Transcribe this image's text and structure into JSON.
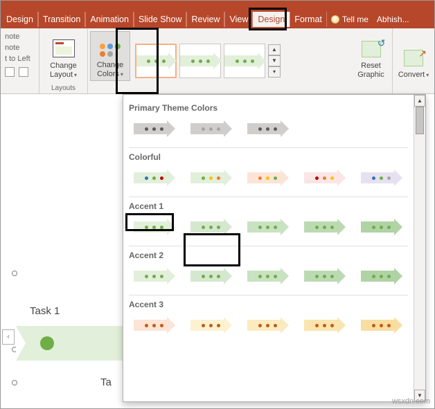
{
  "tabs": {
    "design": "Design",
    "transition": "Transition",
    "animation": "Animation",
    "slideshow": "Slide Show",
    "review": "Review",
    "view": "View",
    "design_tools": "Design",
    "format": "Format",
    "tellme": "Tell me",
    "account": "Abhish..."
  },
  "notes": {
    "note1": "note",
    "note2": "note",
    "rtl": "t to Left"
  },
  "ribbon": {
    "layouts_group": "Layouts",
    "change_layout": "Change Layout",
    "change_colors": "Change Colors",
    "reset_graphic": "Reset Graphic",
    "convert": "Convert"
  },
  "dropdown": {
    "primary": "Primary Theme Colors",
    "colorful": "Colorful",
    "accent1": "Accent 1",
    "accent2": "Accent 2",
    "accent3": "Accent 3"
  },
  "slide": {
    "task1": "Task  1",
    "task2": "Ta"
  },
  "watermark": "wsxdn.com"
}
